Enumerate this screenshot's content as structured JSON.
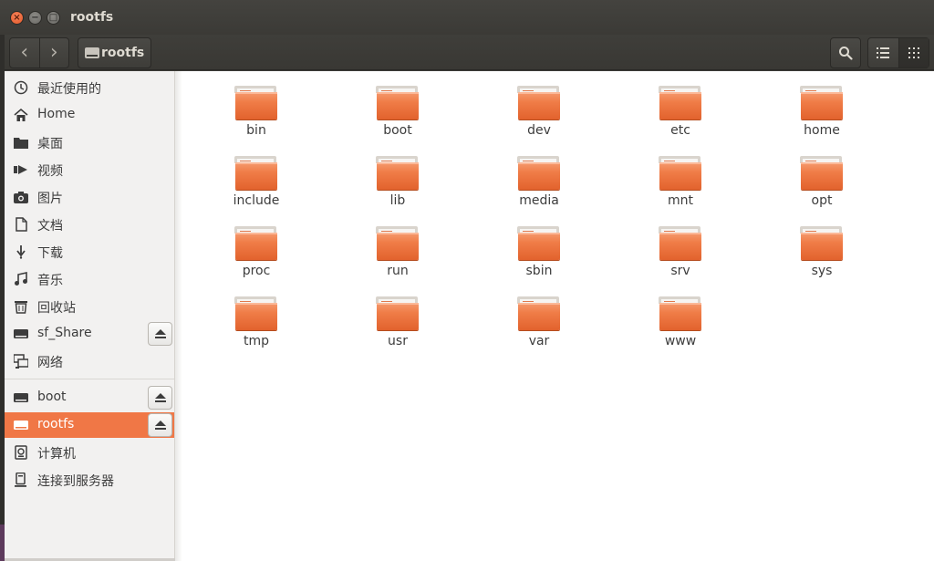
{
  "window": {
    "title": "rootfs",
    "close_glyph": "×",
    "minimize_glyph": "−",
    "maximize_glyph": "□"
  },
  "header": {
    "back_icon": "chevron-left-icon",
    "forward_icon": "chevron-right-icon",
    "back_glyph": "‹",
    "forward_glyph": "›",
    "path_label": "rootfs"
  },
  "sidebar": {
    "items": [
      {
        "label": "最近使用的",
        "icon": "clock-icon"
      },
      {
        "label": "Home",
        "icon": "home-icon"
      },
      {
        "label": "桌面",
        "icon": "folder-icon"
      },
      {
        "label": "视频",
        "icon": "video-icon"
      },
      {
        "label": "图片",
        "icon": "camera-icon"
      },
      {
        "label": "文档",
        "icon": "document-icon"
      },
      {
        "label": "下载",
        "icon": "download-icon"
      },
      {
        "label": "音乐",
        "icon": "music-icon"
      },
      {
        "label": "回收站",
        "icon": "trash-icon"
      },
      {
        "label": "sf_Share",
        "icon": "drive-icon"
      },
      {
        "label": "网络",
        "icon": "network-icon"
      },
      {
        "label": "boot",
        "icon": "drive-icon"
      },
      {
        "label": "rootfs",
        "icon": "drive-icon"
      },
      {
        "label": "计算机",
        "icon": "computer-icon"
      },
      {
        "label": "连接到服务器",
        "icon": "server-icon"
      }
    ]
  },
  "files": [
    "bin",
    "boot",
    "dev",
    "etc",
    "home",
    "include",
    "lib",
    "media",
    "mnt",
    "opt",
    "proc",
    "run",
    "sbin",
    "srv",
    "sys",
    "tmp",
    "usr",
    "var",
    "www"
  ],
  "colors": {
    "accent": "#f07746",
    "titlebar": "#3c3b37",
    "sidebar_bg": "#f2f1f0",
    "folder": "#f07d48"
  }
}
